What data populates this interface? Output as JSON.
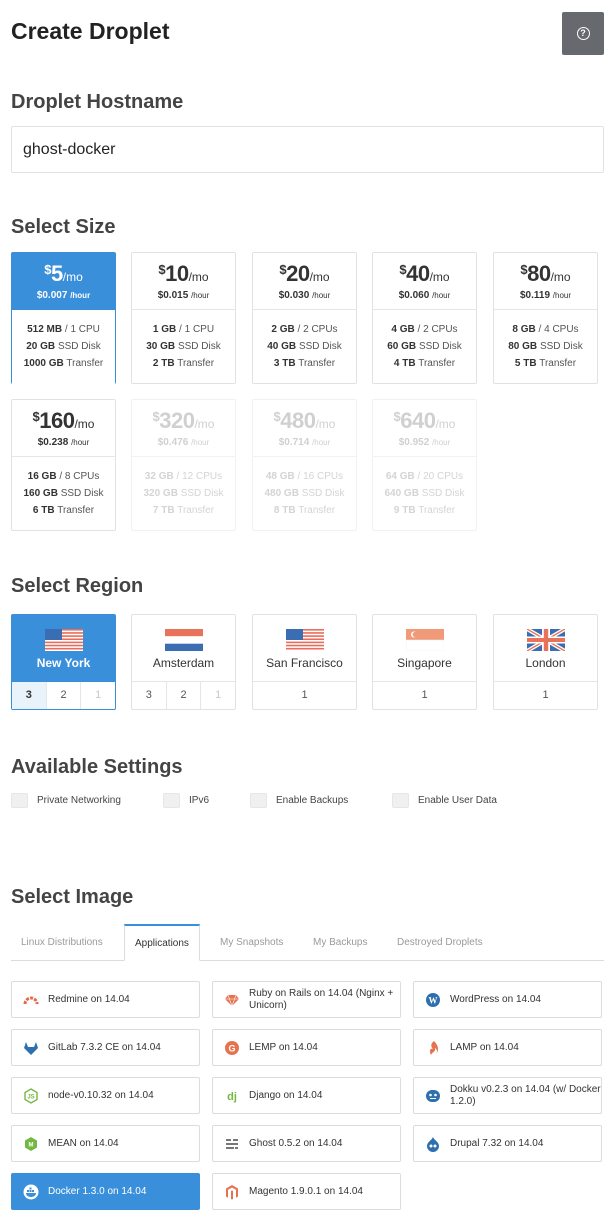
{
  "header": {
    "title": "Create Droplet",
    "help_icon": "question-circle-icon"
  },
  "hostname": {
    "title": "Droplet Hostname",
    "value": "ghost-docker"
  },
  "size": {
    "title": "Select Size",
    "options": [
      {
        "currency": "$",
        "price": "5",
        "per": "/mo",
        "hourly": "$0.007",
        "hourly_unit": "/hour",
        "ram": "512 MB",
        "cpu": "/ 1 CPU",
        "disk": "20 GB",
        "disk_label": "SSD Disk",
        "transfer": "1000 GB",
        "transfer_label": "Transfer",
        "state": "selected"
      },
      {
        "currency": "$",
        "price": "10",
        "per": "/mo",
        "hourly": "$0.015",
        "hourly_unit": "/hour",
        "ram": "1 GB",
        "cpu": "/ 1 CPU",
        "disk": "30 GB",
        "disk_label": "SSD Disk",
        "transfer": "2 TB",
        "transfer_label": "Transfer",
        "state": "normal"
      },
      {
        "currency": "$",
        "price": "20",
        "per": "/mo",
        "hourly": "$0.030",
        "hourly_unit": "/hour",
        "ram": "2 GB",
        "cpu": "/ 2 CPUs",
        "disk": "40 GB",
        "disk_label": "SSD Disk",
        "transfer": "3 TB",
        "transfer_label": "Transfer",
        "state": "normal"
      },
      {
        "currency": "$",
        "price": "40",
        "per": "/mo",
        "hourly": "$0.060",
        "hourly_unit": "/hour",
        "ram": "4 GB",
        "cpu": "/ 2 CPUs",
        "disk": "60 GB",
        "disk_label": "SSD Disk",
        "transfer": "4 TB",
        "transfer_label": "Transfer",
        "state": "normal"
      },
      {
        "currency": "$",
        "price": "80",
        "per": "/mo",
        "hourly": "$0.119",
        "hourly_unit": "/hour",
        "ram": "8 GB",
        "cpu": "/ 4 CPUs",
        "disk": "80 GB",
        "disk_label": "SSD Disk",
        "transfer": "5 TB",
        "transfer_label": "Transfer",
        "state": "normal"
      },
      {
        "currency": "$",
        "price": "160",
        "per": "/mo",
        "hourly": "$0.238",
        "hourly_unit": "/hour",
        "ram": "16 GB",
        "cpu": "/ 8 CPUs",
        "disk": "160 GB",
        "disk_label": "SSD Disk",
        "transfer": "6 TB",
        "transfer_label": "Transfer",
        "state": "normal"
      },
      {
        "currency": "$",
        "price": "320",
        "per": "/mo",
        "hourly": "$0.476",
        "hourly_unit": "/hour",
        "ram": "32 GB",
        "cpu": "/ 12 CPUs",
        "disk": "320 GB",
        "disk_label": "SSD Disk",
        "transfer": "7 TB",
        "transfer_label": "Transfer",
        "state": "disabled"
      },
      {
        "currency": "$",
        "price": "480",
        "per": "/mo",
        "hourly": "$0.714",
        "hourly_unit": "/hour",
        "ram": "48 GB",
        "cpu": "/ 16 CPUs",
        "disk": "480 GB",
        "disk_label": "SSD Disk",
        "transfer": "8 TB",
        "transfer_label": "Transfer",
        "state": "disabled"
      },
      {
        "currency": "$",
        "price": "640",
        "per": "/mo",
        "hourly": "$0.952",
        "hourly_unit": "/hour",
        "ram": "64 GB",
        "cpu": "/ 20 CPUs",
        "disk": "640 GB",
        "disk_label": "SSD Disk",
        "transfer": "9 TB",
        "transfer_label": "Transfer",
        "state": "disabled"
      }
    ]
  },
  "region": {
    "title": "Select Region",
    "options": [
      {
        "name": "New York",
        "flag": "us-flag-icon",
        "datacenters": [
          "3",
          "2",
          "1"
        ],
        "state": "selected"
      },
      {
        "name": "Amsterdam",
        "flag": "nl-flag-icon",
        "datacenters": [
          "3",
          "2",
          "1"
        ],
        "state": "normal"
      },
      {
        "name": "San Francisco",
        "flag": "us-flag-icon",
        "datacenters": [
          "1"
        ],
        "state": "normal"
      },
      {
        "name": "Singapore",
        "flag": "sg-flag-icon",
        "datacenters": [
          "1"
        ],
        "state": "normal"
      },
      {
        "name": "London",
        "flag": "uk-flag-icon",
        "datacenters": [
          "1"
        ],
        "state": "normal"
      }
    ]
  },
  "settings": {
    "title": "Available Settings",
    "options": [
      "Private Networking",
      "IPv6",
      "Enable Backups",
      "Enable User Data"
    ]
  },
  "image": {
    "title": "Select Image",
    "tabs": [
      "Linux Distributions",
      "Applications",
      "My Snapshots",
      "My Backups",
      "Destroyed Droplets"
    ],
    "active_tab": "Applications",
    "apps": [
      {
        "label": "Redmine on 14.04",
        "icon": "redmine-icon",
        "color": "#e26a4a"
      },
      {
        "label": "Ruby on Rails on 14.04 (Nginx + Unicorn)",
        "icon": "ruby-gem-icon",
        "color": "#e5734f"
      },
      {
        "label": "WordPress on 14.04",
        "icon": "wordpress-icon",
        "color": "#2e6fad"
      },
      {
        "label": "GitLab 7.3.2 CE on 14.04",
        "icon": "gitlab-icon",
        "color": "#2e6fad"
      },
      {
        "label": "LEMP on 14.04",
        "icon": "lemp-icon",
        "color": "#e5734f"
      },
      {
        "label": "LAMP on 14.04",
        "icon": "lamp-icon",
        "color": "#e5734f"
      },
      {
        "label": "node-v0.10.32 on 14.04",
        "icon": "nodejs-icon",
        "color": "#74b843"
      },
      {
        "label": "Django on 14.04",
        "icon": "django-icon",
        "color": "#74b843"
      },
      {
        "label": "Dokku v0.2.3 on 14.04 (w/ Docker 1.2.0)",
        "icon": "dokku-icon",
        "color": "#2e6fad"
      },
      {
        "label": "MEAN on 14.04",
        "icon": "mean-icon",
        "color": "#74b843"
      },
      {
        "label": "Ghost 0.5.2 on 14.04",
        "icon": "ghost-icon",
        "color": "#777777"
      },
      {
        "label": "Drupal 7.32 on 14.04",
        "icon": "drupal-icon",
        "color": "#2e6fad"
      },
      {
        "label": "Docker 1.3.0 on 14.04",
        "icon": "docker-icon",
        "color": "#ffffff",
        "selected": true
      },
      {
        "label": "Magento 1.9.0.1 on 14.04",
        "icon": "magento-icon",
        "color": "#e5734f"
      }
    ]
  },
  "colors": {
    "accent": "#3a8fdb",
    "help_bg": "#666a6e"
  }
}
